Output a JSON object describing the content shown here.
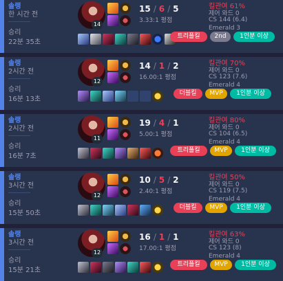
{
  "matches": [
    {
      "queue": "솔랭",
      "time_ago": "한 시간 전",
      "result": "승리",
      "duration": "22분 35초",
      "level": "14",
      "kda": {
        "k": "15",
        "d": "6",
        "a": "5",
        "ratio": "3.33:1 평점"
      },
      "kill_participation": "킬관여 61%",
      "control_ward": "제어 와드 0",
      "cs": "CS 144 (6.4)",
      "rank": "Emerald 3",
      "badges": [
        "트리플킬",
        "2nd",
        "1인분 이상"
      ]
    },
    {
      "queue": "솔랭",
      "time_ago": "2시간 전",
      "result": "승리",
      "duration": "16분 13초",
      "level": "12",
      "kda": {
        "k": "14",
        "d": "1",
        "a": "2",
        "ratio": "16.00:1 평점"
      },
      "kill_participation": "킬관여 70%",
      "control_ward": "제어 와드 0",
      "cs": "CS 123 (7.6)",
      "rank": "Emerald 4",
      "badges": [
        "더블킬",
        "MVP",
        "1인분 이상"
      ]
    },
    {
      "queue": "솔랭",
      "time_ago": "2시간 전",
      "result": "승리",
      "duration": "16분 7초",
      "level": "11",
      "kda": {
        "k": "19",
        "d": "4",
        "a": "1",
        "ratio": "5.00:1 평점"
      },
      "kill_participation": "킬관여 80%",
      "control_ward": "제어 와드 0",
      "cs": "CS 104 (6.5)",
      "rank": "Emerald 4",
      "badges": [
        "트리플킬",
        "MVP",
        "1인분 이상"
      ]
    },
    {
      "queue": "솔랭",
      "time_ago": "3시간 전",
      "result": "승리",
      "duration": "15분 50초",
      "level": "12",
      "kda": {
        "k": "10",
        "d": "5",
        "a": "2",
        "ratio": "2.40:1 평점"
      },
      "kill_participation": "킬관여 50%",
      "control_ward": "제어 와드 0",
      "cs": "CS 119 (7.5)",
      "rank": "Emerald 4",
      "badges": [
        "더블킬",
        "MVP",
        "1인분 이상"
      ]
    },
    {
      "queue": "솔랭",
      "time_ago": "3시간 전",
      "result": "승리",
      "duration": "15분 21초",
      "level": "12",
      "kda": {
        "k": "16",
        "d": "1",
        "a": "1",
        "ratio": "17.00:1 평점"
      },
      "kill_participation": "킬관여 63%",
      "control_ward": "제어 와드 0",
      "cs": "CS 123 (8)",
      "rank": "Emerald 4",
      "badges": [
        "트리플킬",
        "MVP",
        "1인분 이상"
      ]
    }
  ],
  "colors": {
    "win_accent": "#5383e8",
    "death": "#e84057",
    "mvp": "#e2a500",
    "green": "#00bba3"
  }
}
